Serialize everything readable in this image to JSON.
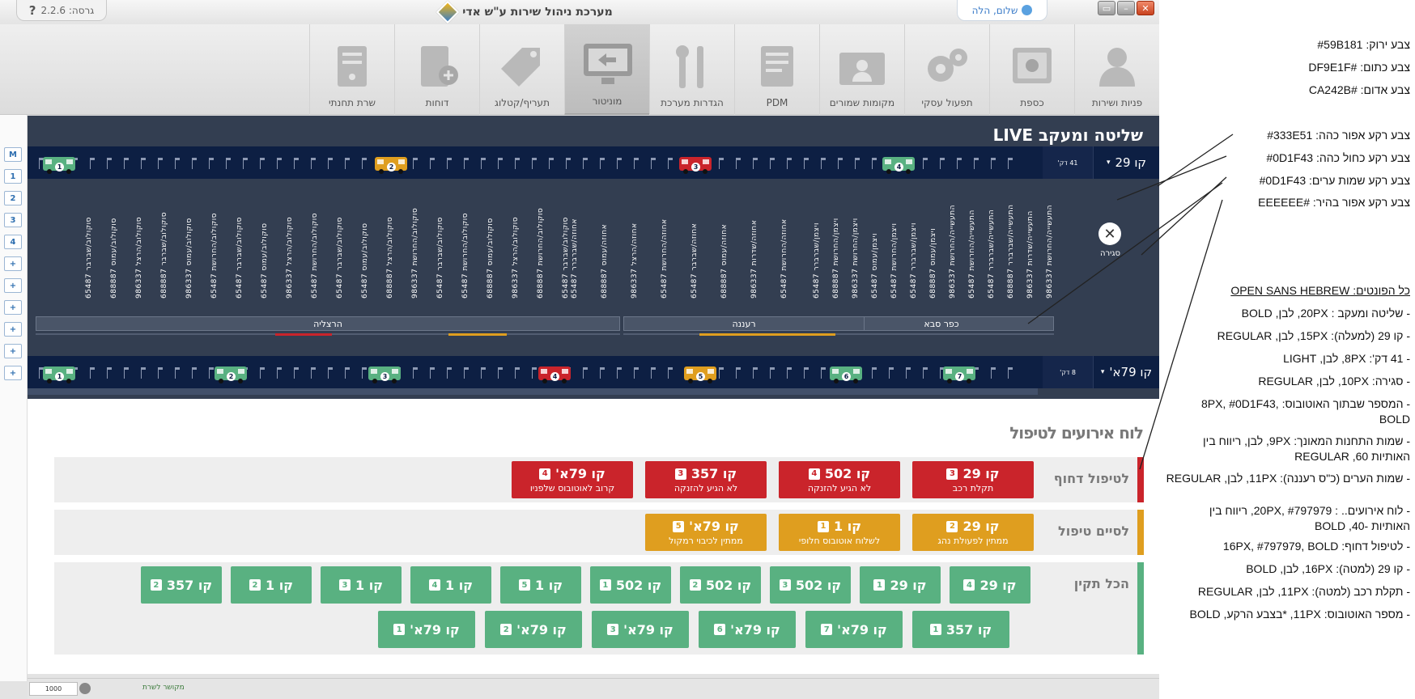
{
  "titlebar": {
    "version": "גרסה: 2.2.6",
    "help": "?",
    "app_title": "מערכת ניהול שירות ע\"ש אדי",
    "user": "שלום, הלה"
  },
  "toolbar": [
    {
      "label": "פניות ושירות",
      "icon": "user-icon"
    },
    {
      "label": "כספת",
      "icon": "safe-icon"
    },
    {
      "label": "תפעול עסקי",
      "icon": "gears-icon"
    },
    {
      "label": "מקומות שמורים",
      "icon": "id-card-icon"
    },
    {
      "label": "PDM",
      "icon": "folder-icon"
    },
    {
      "label": "הגדרות מערכת",
      "icon": "tools-icon"
    },
    {
      "label": "מוניטור",
      "icon": "monitor-icon",
      "active": true
    },
    {
      "label": "תעריף/קטלוג",
      "icon": "tag-icon"
    },
    {
      "label": "דוחות",
      "icon": "report-icon"
    },
    {
      "label": "שרת תחנתי",
      "icon": "server-icon"
    }
  ],
  "left_strip": [
    "M",
    "1",
    "2",
    "3",
    "4",
    "+",
    "+",
    "+",
    "+",
    "+",
    "+"
  ],
  "live": {
    "title": "שליטה ומעקב LIVE",
    "line1": {
      "label": "קו 29",
      "mins": "41 דק'"
    },
    "line2": {
      "label": "קו 79א'",
      "mins": "8 דק'"
    },
    "close_label": "סגירה",
    "close_icon": "close-icon",
    "cities": [
      "כפר סבא",
      "רעננה",
      "הרצליה"
    ],
    "stations": [
      "התעשייה/החרושת 986337",
      "התעשייה/שדרות 986337",
      "התעשייה/שברברר 688887",
      "התעשייה/שברברר 65487",
      "התעשייה/החרושת 65487",
      "התעשייה/החרושת 986337",
      "ויצמן/עמוס 688887",
      "ויצמן/שברברר 65487",
      "ויצמן/החרושת 65487",
      "ויצמן/עמוס 65487",
      "ויצמן/החרושת 986337",
      "ויצמן/החרושת 688887",
      "ויצמן/שברברר 65487",
      "אחוזה/החרושת 65487",
      "אחוזה/שדרות 986337",
      "אחוזה/עמוס 688887",
      "אחוזה/שברבר 65487",
      "אחוזה/החרושת 65487",
      "אחוזה/הרצל 986337",
      "אחוזה/עמוס 688887",
      "אחוזה/שברברר 65487",
      "סוקולוב/שברבר 65487",
      "סוקולוב/החרושת 688887",
      "סוקולוב/הרצל 986337",
      "סוקולוב/עמוס 688887",
      "סוקולוב/החרושת 65487",
      "סוקולוב/שברבר 65487",
      "סוקולוב/החרושת 986337",
      "סוקולוב/הרצל 688887",
      "סוקולוב/עמוס 65487",
      "סוקולוב/שברבר 65487",
      "סוקולוב/החרושת 65487",
      "סוקולוב/הרצל 986337",
      "סוקולוב/עמוס 65487",
      "סוקולוב/שברבר 65487",
      "סוקולוב/החרושת 65487",
      "סוקולוב/עמוס 986337",
      "סוקולוב/שברבר 688887",
      "סוקולוב/הרצל 986337",
      "סוקולוב/עמוס 688887",
      "סוקולוב/שברבר 65487"
    ]
  },
  "events": {
    "title": "לוח אירועים לטיפול",
    "urgent": {
      "label": "לטיפול דחוף",
      "cards": [
        {
          "line": "קו 29",
          "num": "3",
          "sub": "תקלת רכב"
        },
        {
          "line": "קו 502",
          "num": "4",
          "sub": "לא הגיע להזנקה"
        },
        {
          "line": "קו 357",
          "num": "3",
          "sub": "לא הגיע להזנקה"
        },
        {
          "line": "קו 79א'",
          "num": "4",
          "sub": "קרוב לאוטובוס שלפניו"
        }
      ]
    },
    "finish": {
      "label": "לסיים טיפול",
      "cards": [
        {
          "line": "קו 29",
          "num": "2",
          "sub": "ממתין לפעולת נהג"
        },
        {
          "line": "קו 1",
          "num": "1",
          "sub": "לשלוח אוטובוס חלופי"
        },
        {
          "line": "קו 79א'",
          "num": "5",
          "sub": "ממתין לכיבוי רמקול"
        }
      ]
    },
    "ok": {
      "label": "הכל תקין",
      "row1": [
        {
          "line": "קו 29",
          "num": "4"
        },
        {
          "line": "קו 29",
          "num": "1"
        },
        {
          "line": "קו 502",
          "num": "3"
        },
        {
          "line": "קו 502",
          "num": "2"
        },
        {
          "line": "קו 502",
          "num": "1"
        },
        {
          "line": "קו 1",
          "num": "5"
        },
        {
          "line": "קו 1",
          "num": "4"
        },
        {
          "line": "קו 1",
          "num": "3"
        },
        {
          "line": "קו 1",
          "num": "2"
        },
        {
          "line": "קו 357",
          "num": "2"
        }
      ],
      "row2": [
        {
          "line": "קו 357",
          "num": "1"
        },
        {
          "line": "קו 79א'",
          "num": "7"
        },
        {
          "line": "קו 79א'",
          "num": "6"
        },
        {
          "line": "קו 79א'",
          "num": "3"
        },
        {
          "line": "קו 79א'",
          "num": "2"
        },
        {
          "line": "קו 79א'",
          "num": "1"
        }
      ]
    }
  },
  "statusbar": {
    "value": "1000",
    "label": "מקושר לשרת"
  },
  "notes": [
    "צבע ירוק: #59B181",
    "צבע כתום: #DF9E1F",
    "צבע אדום: #CA242B",
    "צבע רקע אפור כהה: #333E51",
    "צבע רקע כחול כהה: #0D1F43",
    "צבע רקע שמות ערים: #0D1F43",
    "צבע רקע אפור בהיר: #EEEEEE",
    "כל הפונטים: OPEN SANS HEBREW",
    "- שליטה ומעקב : 20PX, לבן, BOLD",
    "- קו 29 (למעלה): 15PX, לבן, REGULAR",
    "- 41 דק': 8PX, לבן, LIGHT",
    "- סגירה: 10PX, לבן, REGULAR",
    "- המספר שבתוך האוטובוס: 8PX, #0D1F43, BOLD",
    "- שמות התחנות המאונך: 9PX, לבן, ריווח בין האותיות 60, REGULAR",
    "- שמות הערים (כ\"ס רעננה): 11PX, לבן, REGULAR",
    "- לוח אירועים.. : 20PX, #797979, ריווח בין האותיות -40, BOLD",
    "- לטיפול דחוף: 16PX, #797979, BOLD",
    "- קו 29 (למטה): 16PX, לבן, BOLD",
    "- תקלת רכב (למטה): 11PX, לבן, REGULAR",
    "- מספר האוטובוס: 11PX, *בצבע הרקע, BOLD"
  ],
  "colors": {
    "green": "#59B181",
    "orange": "#DF9E1F",
    "red": "#CA242B",
    "dark_gray": "#333E51",
    "dark_blue": "#0D1F43",
    "light_gray": "#EEEEEE"
  }
}
